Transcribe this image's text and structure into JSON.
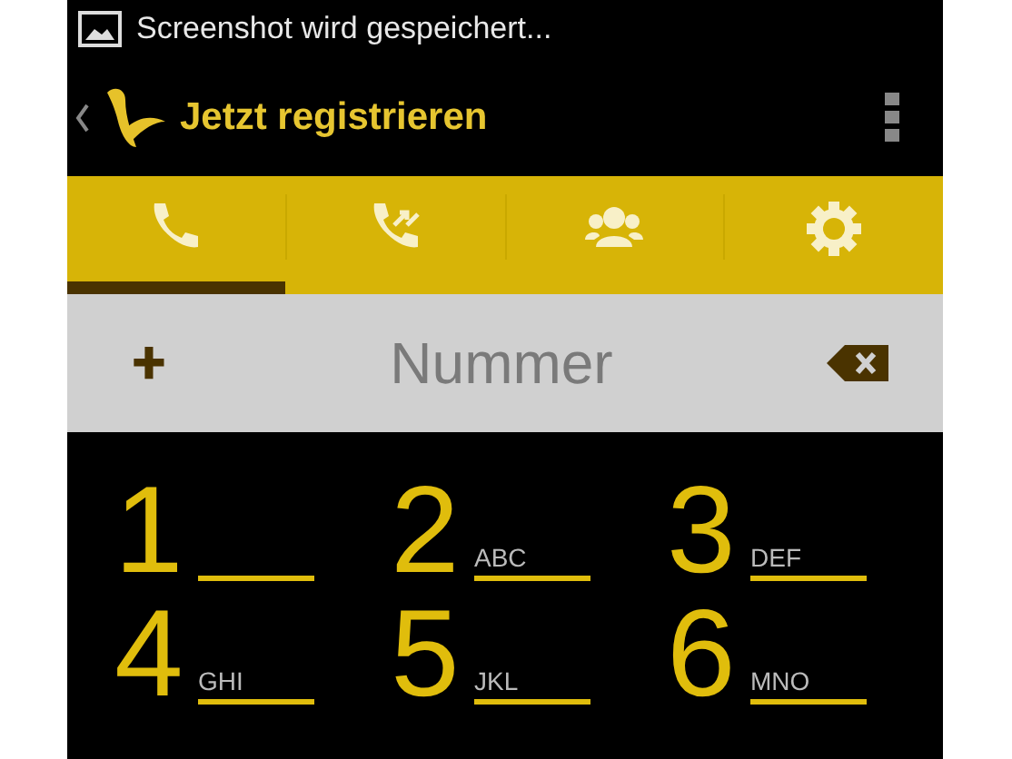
{
  "status_bar": {
    "notification": "Screenshot wird gespeichert..."
  },
  "action_bar": {
    "title": "Jetzt registrieren"
  },
  "tabs": [
    {
      "kind": "dialer",
      "selected": true
    },
    {
      "kind": "calls",
      "selected": false
    },
    {
      "kind": "contacts",
      "selected": false
    },
    {
      "kind": "settings",
      "selected": false
    }
  ],
  "number_field": {
    "prefix_button": "+",
    "placeholder": "Nummer"
  },
  "keypad": [
    {
      "digit": "1"
    },
    {
      "digit": "2",
      "letters": "ABC"
    },
    {
      "digit": "3",
      "letters": "DEF"
    },
    {
      "digit": "4",
      "letters": "GHI"
    },
    {
      "digit": "5",
      "letters": "JKL"
    },
    {
      "digit": "6",
      "letters": "MNO"
    }
  ]
}
